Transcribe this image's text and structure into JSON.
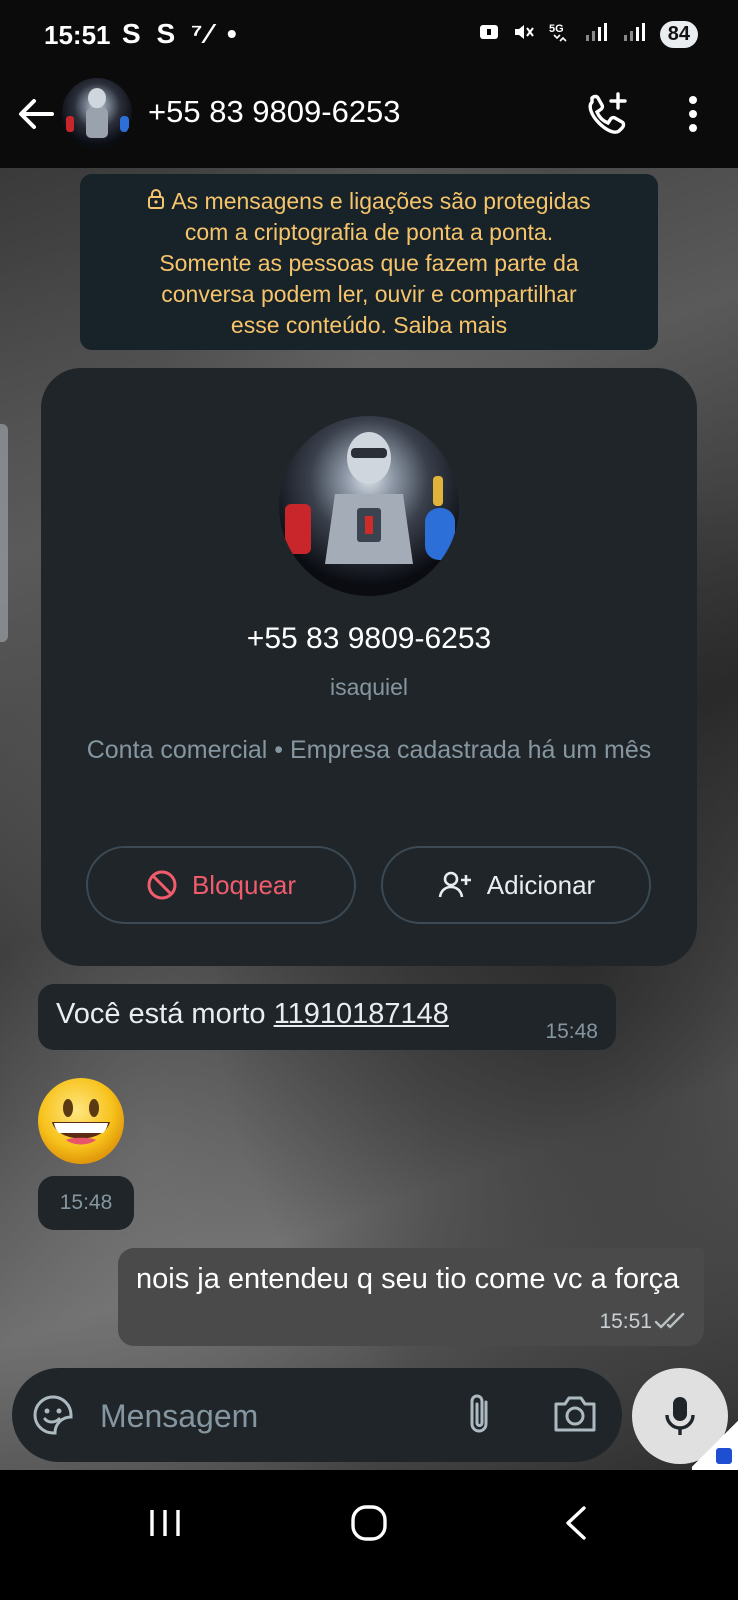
{
  "status_bar": {
    "time": "15:51",
    "left_icons": "S S ⁷⁄ •",
    "battery": "84"
  },
  "header": {
    "title": "+55 83 9809-6253"
  },
  "encryption_notice": {
    "text_line1": "As mensagens e ligações são protegidas",
    "text_line2": "com a criptografia de ponta a ponta.",
    "text_line3": "Somente as pessoas que fazem parte da",
    "text_line4": "conversa podem ler, ouvir e compartilhar",
    "text_line5": "esse conteúdo. Saiba mais"
  },
  "profile_card": {
    "name": "+55 83 9809-6253",
    "subtitle": "isaquiel",
    "description": "Conta comercial • Empresa cadastrada há um mês",
    "block_label": "Bloquear",
    "add_label": "Adicionar"
  },
  "messages": {
    "incoming_text": "Você está morto ",
    "incoming_link": "11910187148",
    "incoming_time": "15:48",
    "emoji_time": "15:48",
    "outgoing_text": "nois ja entendeu q seu tio come vc a força",
    "outgoing_time": "15:51"
  },
  "composer": {
    "placeholder": "Mensagem"
  },
  "colors": {
    "accent_warning": "#f5c46b",
    "block_red": "#f15c6d",
    "card_bg": "#1f2529"
  }
}
